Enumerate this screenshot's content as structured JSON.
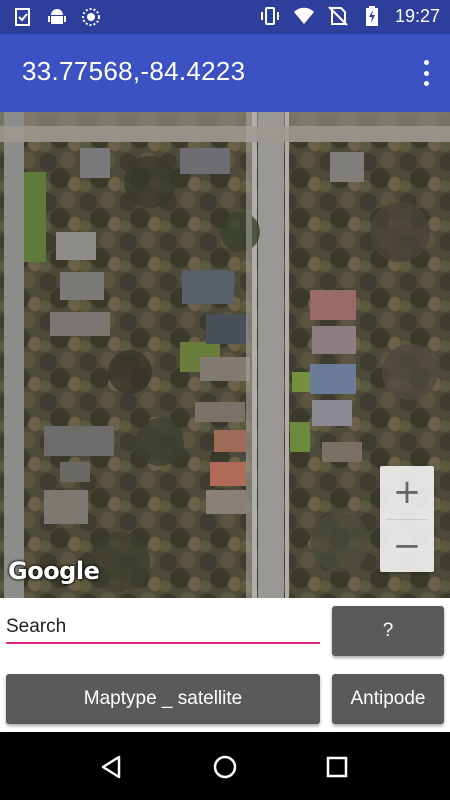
{
  "status_bar": {
    "time": "19:27",
    "left_icons": [
      "clipboard-check-icon",
      "android-icon",
      "circle-pattern-icon"
    ],
    "right_icons": [
      "vibrate-icon",
      "wifi-icon",
      "no-sim-icon",
      "battery-charging-icon"
    ]
  },
  "app_bar": {
    "title": "33.77568,-84.4223",
    "overflow_icon": "more-vert-icon"
  },
  "map": {
    "type": "satellite",
    "attribution": "Google",
    "zoom_in_label": "+",
    "zoom_out_label": "−"
  },
  "controls": {
    "search_value": "Search",
    "help_label": "?",
    "maptype_label": "Maptype _ satellite",
    "antipode_label": "Antipode"
  },
  "colors": {
    "status_bar": "#2d3f9a",
    "app_bar": "#3d52c2",
    "accent": "#e0247f",
    "button": "#5a5a5a"
  }
}
